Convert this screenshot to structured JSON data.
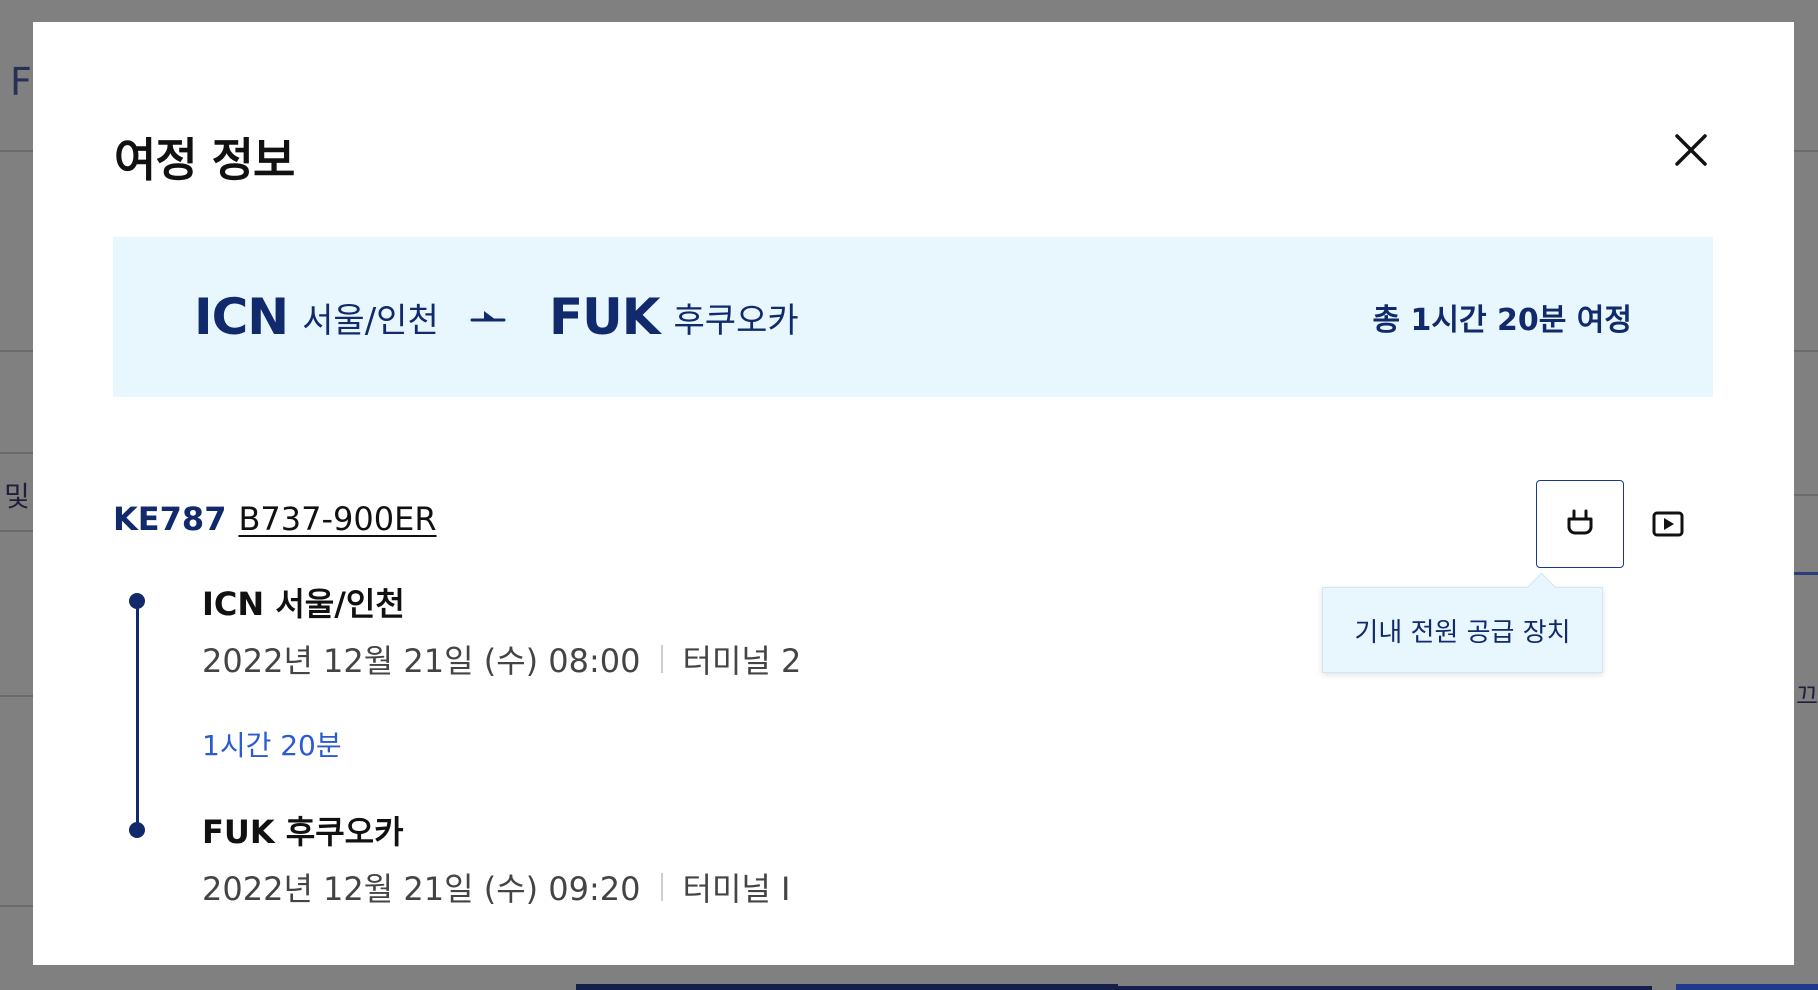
{
  "background": {
    "partial_letter": "F",
    "partial_left_text": "및",
    "partial_right_text": "끄"
  },
  "modal": {
    "title": "여정 정보",
    "close_icon": "close-icon"
  },
  "route": {
    "origin_code": "ICN",
    "origin_city": "서울/인천",
    "destination_code": "FUK",
    "destination_city": "후쿠오카",
    "total_label": "총 1시간 20분 여정",
    "direction_icon": "plane-icon"
  },
  "flight": {
    "number": "KE787",
    "aircraft": "B737-900ER"
  },
  "amenities": {
    "power_icon": "power-plug-icon",
    "video_icon": "video-play-icon",
    "tooltip": "기내 전원 공급 장치"
  },
  "segments": {
    "departure": {
      "title": "ICN 서울/인천",
      "datetime": "2022년 12월 21일 (수) 08:00",
      "terminal": "터미널 2"
    },
    "duration": "1시간 20분",
    "arrival": {
      "title": "FUK 후쿠오카",
      "datetime": "2022년 12월 21일 (수) 09:20",
      "terminal": "터미널 I"
    }
  },
  "colors": {
    "overlay": "#808080",
    "brand_navy": "#102a6b",
    "banner_bg": "#e8f6fd",
    "duration_blue": "#2a5bd0"
  }
}
